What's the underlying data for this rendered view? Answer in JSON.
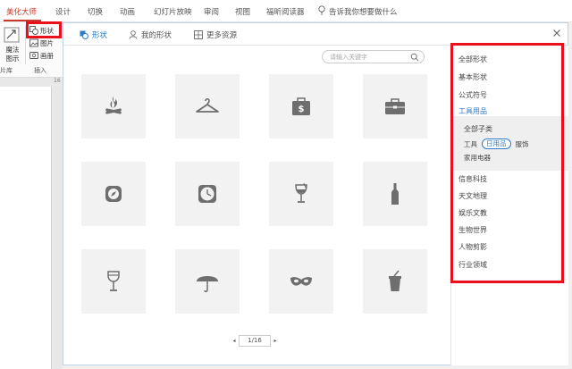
{
  "ribbon": {
    "tabs": [
      "美化大师",
      "设计",
      "切换",
      "动画",
      "幻灯片放映",
      "审阅",
      "视图",
      "福昕阅读器"
    ],
    "tell_me": "告诉我你想要做什么",
    "magic_label": "魔法图示",
    "lib_label": "片库",
    "insert_label": "插入",
    "items": [
      "形状",
      "图片",
      "画册"
    ],
    "ruler": "16"
  },
  "dialog": {
    "tabs": [
      "形状",
      "我的形状",
      "更多资源"
    ],
    "search": {
      "placeholder": "请输入关键字",
      "value": ""
    },
    "icons": [
      "campfire-icon",
      "hanger-icon",
      "money-briefcase-icon",
      "briefcase-icon",
      "compass-icon",
      "wall-clock-icon",
      "wine-glass-icon",
      "bottle-icon",
      "goblet-icon",
      "umbrella-icon",
      "mask-icon",
      "drink-cup-icon"
    ],
    "pager": {
      "prev": "◂",
      "current": "1/16",
      "next": "▸"
    },
    "categories": [
      "全部形状",
      "基本形状",
      "公式符号",
      "工具用品"
    ],
    "active_category": "工具用品",
    "sub": {
      "title": "全部子类",
      "row1": [
        "工具",
        "日用品",
        "服饰"
      ],
      "row2": "家用电器",
      "active": "日用品"
    },
    "more_categories": [
      "信息科技",
      "天文地理",
      "娱乐文教",
      "生物世界",
      "人物剪影",
      "行业领域"
    ]
  },
  "colors": {
    "accent": "#2e7bc4",
    "ribbon_active": "#c8392b",
    "highlight": "#e8101a",
    "icon": "#6e6e6e"
  }
}
